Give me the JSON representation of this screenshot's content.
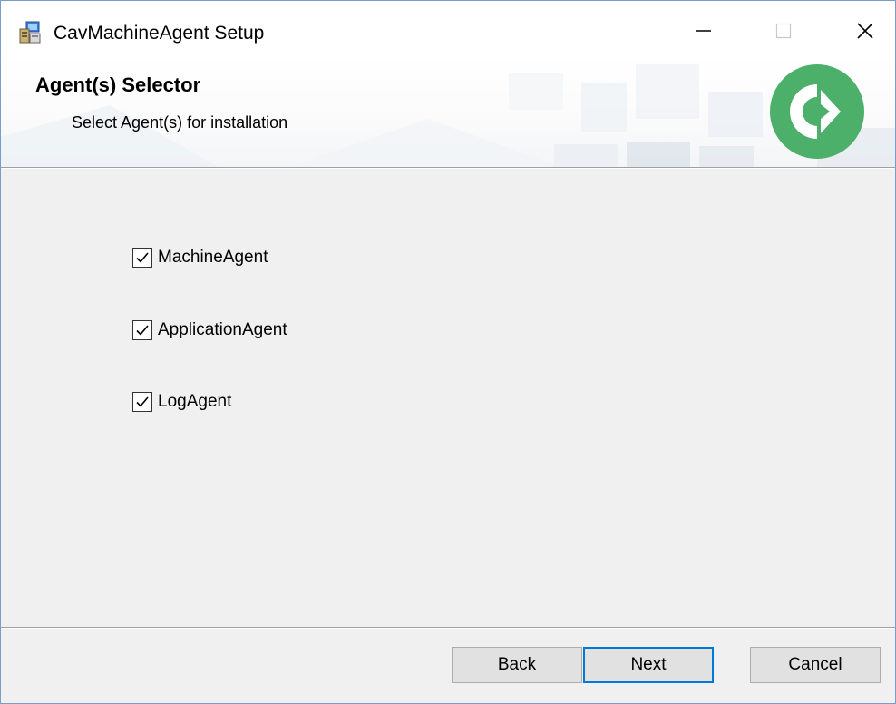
{
  "window": {
    "title": "CavMachineAgent Setup",
    "controls": {
      "minimize_icon": "minimize-icon",
      "maximize_icon": "maximize-icon",
      "close_icon": "close-icon"
    }
  },
  "banner": {
    "title": "Agent(s) Selector",
    "subtitle": "Select Agent(s) for installation",
    "logo_color": "#4caf6a"
  },
  "agents": [
    {
      "label": "MachineAgent",
      "checked": true
    },
    {
      "label": "ApplicationAgent",
      "checked": true
    },
    {
      "label": "LogAgent",
      "checked": true
    }
  ],
  "buttons": {
    "back": "Back",
    "next": "Next",
    "cancel": "Cancel"
  },
  "colors": {
    "focus_border": "#0078d7",
    "window_border": "#7a9cc6"
  }
}
